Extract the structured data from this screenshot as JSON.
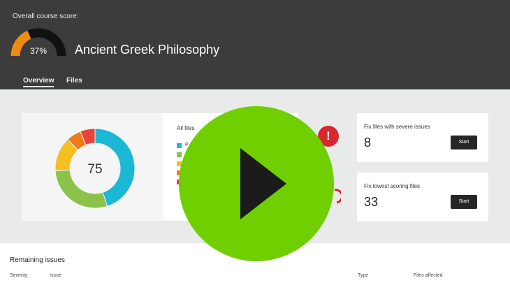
{
  "header": {
    "score_caption": "Overall course score:",
    "score_value": "37%",
    "score_fraction": 0.37,
    "course_title": "Ancient Greek Philosophy",
    "colors": {
      "gauge_fill": "#ef8a12",
      "gauge_track": "#111111"
    }
  },
  "tabs": [
    {
      "label": "Overview",
      "active": true
    },
    {
      "label": "Files",
      "active": false
    }
  ],
  "overview": {
    "center_value": "75",
    "donut_segments": [
      {
        "color": "#1ab8d4",
        "fraction": 0.45
      },
      {
        "color": "#8bc34a",
        "fraction": 0.29
      },
      {
        "color": "#f6bf1f",
        "fraction": 0.14
      },
      {
        "color": "#f07a1a",
        "fraction": 0.06
      },
      {
        "color": "#e8423b",
        "fraction": 0.06
      }
    ],
    "legend_title": "All files",
    "legend_colors": [
      "#1ab8d4",
      "#8bc34a",
      "#f6bf1f",
      "#f07a1a",
      "#e8423b"
    ],
    "legend_first_label": "P"
  },
  "issues": [
    {
      "title": "Fix files with severe issues",
      "count": "8",
      "button": "Start",
      "icon": "severe-issue-icon"
    },
    {
      "title": "Fix lowest scoring files",
      "count": "33",
      "button": "Start",
      "icon": "gauge-icon"
    }
  ],
  "remaining": {
    "title": "Remaining issues",
    "columns": [
      "Severity",
      "Issue",
      "Type",
      "Files affected"
    ]
  },
  "overlay": {
    "icon": "play-icon",
    "color": "#6fcf00"
  }
}
